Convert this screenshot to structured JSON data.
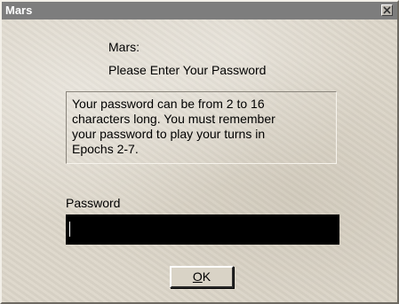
{
  "window": {
    "title": "Mars",
    "close_icon": "close-x-icon"
  },
  "dialog": {
    "heading_name": "Mars:",
    "heading_prompt": "Please Enter Your Password",
    "info_text": "Your password can be from 2 to 16\ncharacters long.  You must remember\nyour password to play your turns in\nEpochs 2-7.",
    "password_label": "Password",
    "password_value": "",
    "ok_mnemonic": "O",
    "ok_rest": "K"
  },
  "colors": {
    "title_bar": "#7d7d7d",
    "dialog_background": "#ddd7ca",
    "input_background": "#000000"
  }
}
